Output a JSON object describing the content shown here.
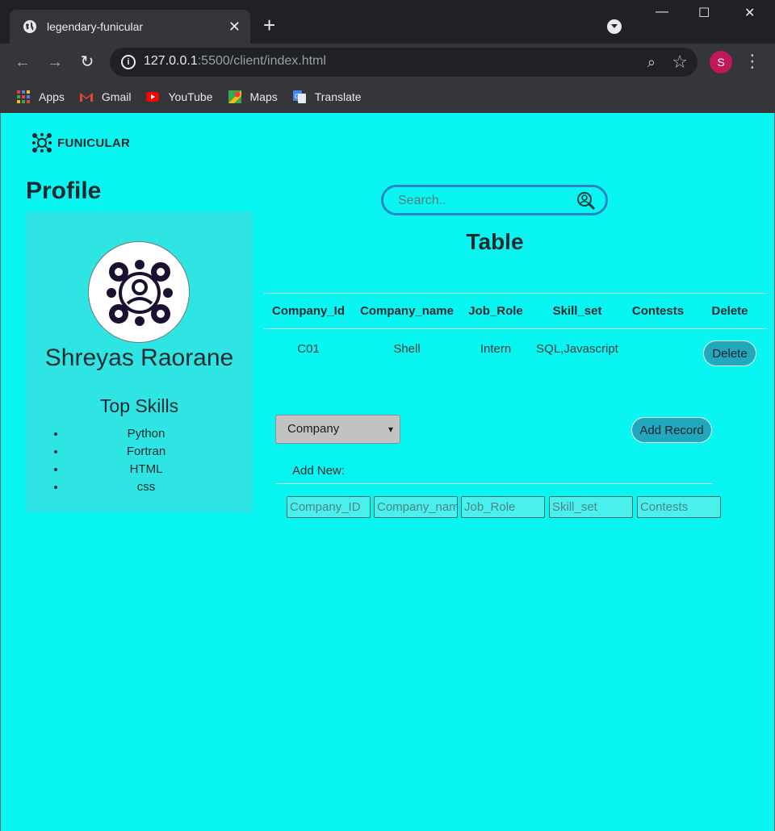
{
  "browser": {
    "tab_title": "legendary-funicular",
    "new_tab": "+",
    "close_tab": "✕",
    "url_host": "127.0.0.1",
    "url_rest": ":5500/client/index.html",
    "profile_initial": "S",
    "window_controls": {
      "minimize": "—",
      "maximize": "☐",
      "close": "✕"
    },
    "bookmarks": [
      {
        "label": "Apps",
        "icon": "apps-grid-icon"
      },
      {
        "label": "Gmail",
        "icon": "gmail-icon"
      },
      {
        "label": "YouTube",
        "icon": "youtube-icon"
      },
      {
        "label": "Maps",
        "icon": "maps-icon"
      },
      {
        "label": "Translate",
        "icon": "translate-icon"
      }
    ]
  },
  "header": {
    "logo_text": "FUNICULAR"
  },
  "profile": {
    "heading": "Profile",
    "name": "Shreyas Raorane",
    "skills_title": "Top Skills",
    "skills": [
      "Python",
      "Fortran",
      "HTML",
      "css"
    ]
  },
  "search": {
    "placeholder": "Search.."
  },
  "table": {
    "title": "Table",
    "headers": [
      "Company_Id",
      "Company_name",
      "Job_Role",
      "Skill_set",
      "Contests",
      "Delete"
    ],
    "rows": [
      {
        "company_id": "C01",
        "company_name": "Shell",
        "job_role": "Intern",
        "skill_set": "SQL,Javascript",
        "contests": "",
        "delete_label": "Delete"
      }
    ]
  },
  "form": {
    "select_value": "Company",
    "add_record_label": "Add Record",
    "add_new_label": "Add New:",
    "placeholders": {
      "company_id": "Company_ID",
      "company_name": "Company_name",
      "job_role": "Job_Role",
      "skill_set": "Skill_set",
      "contests": "Contests"
    }
  },
  "colors": {
    "page_bg": "#09f5f2",
    "card_bg": "#2ee5e4",
    "button_bg": "#23a7bd",
    "search_border": "#2a84c6"
  }
}
